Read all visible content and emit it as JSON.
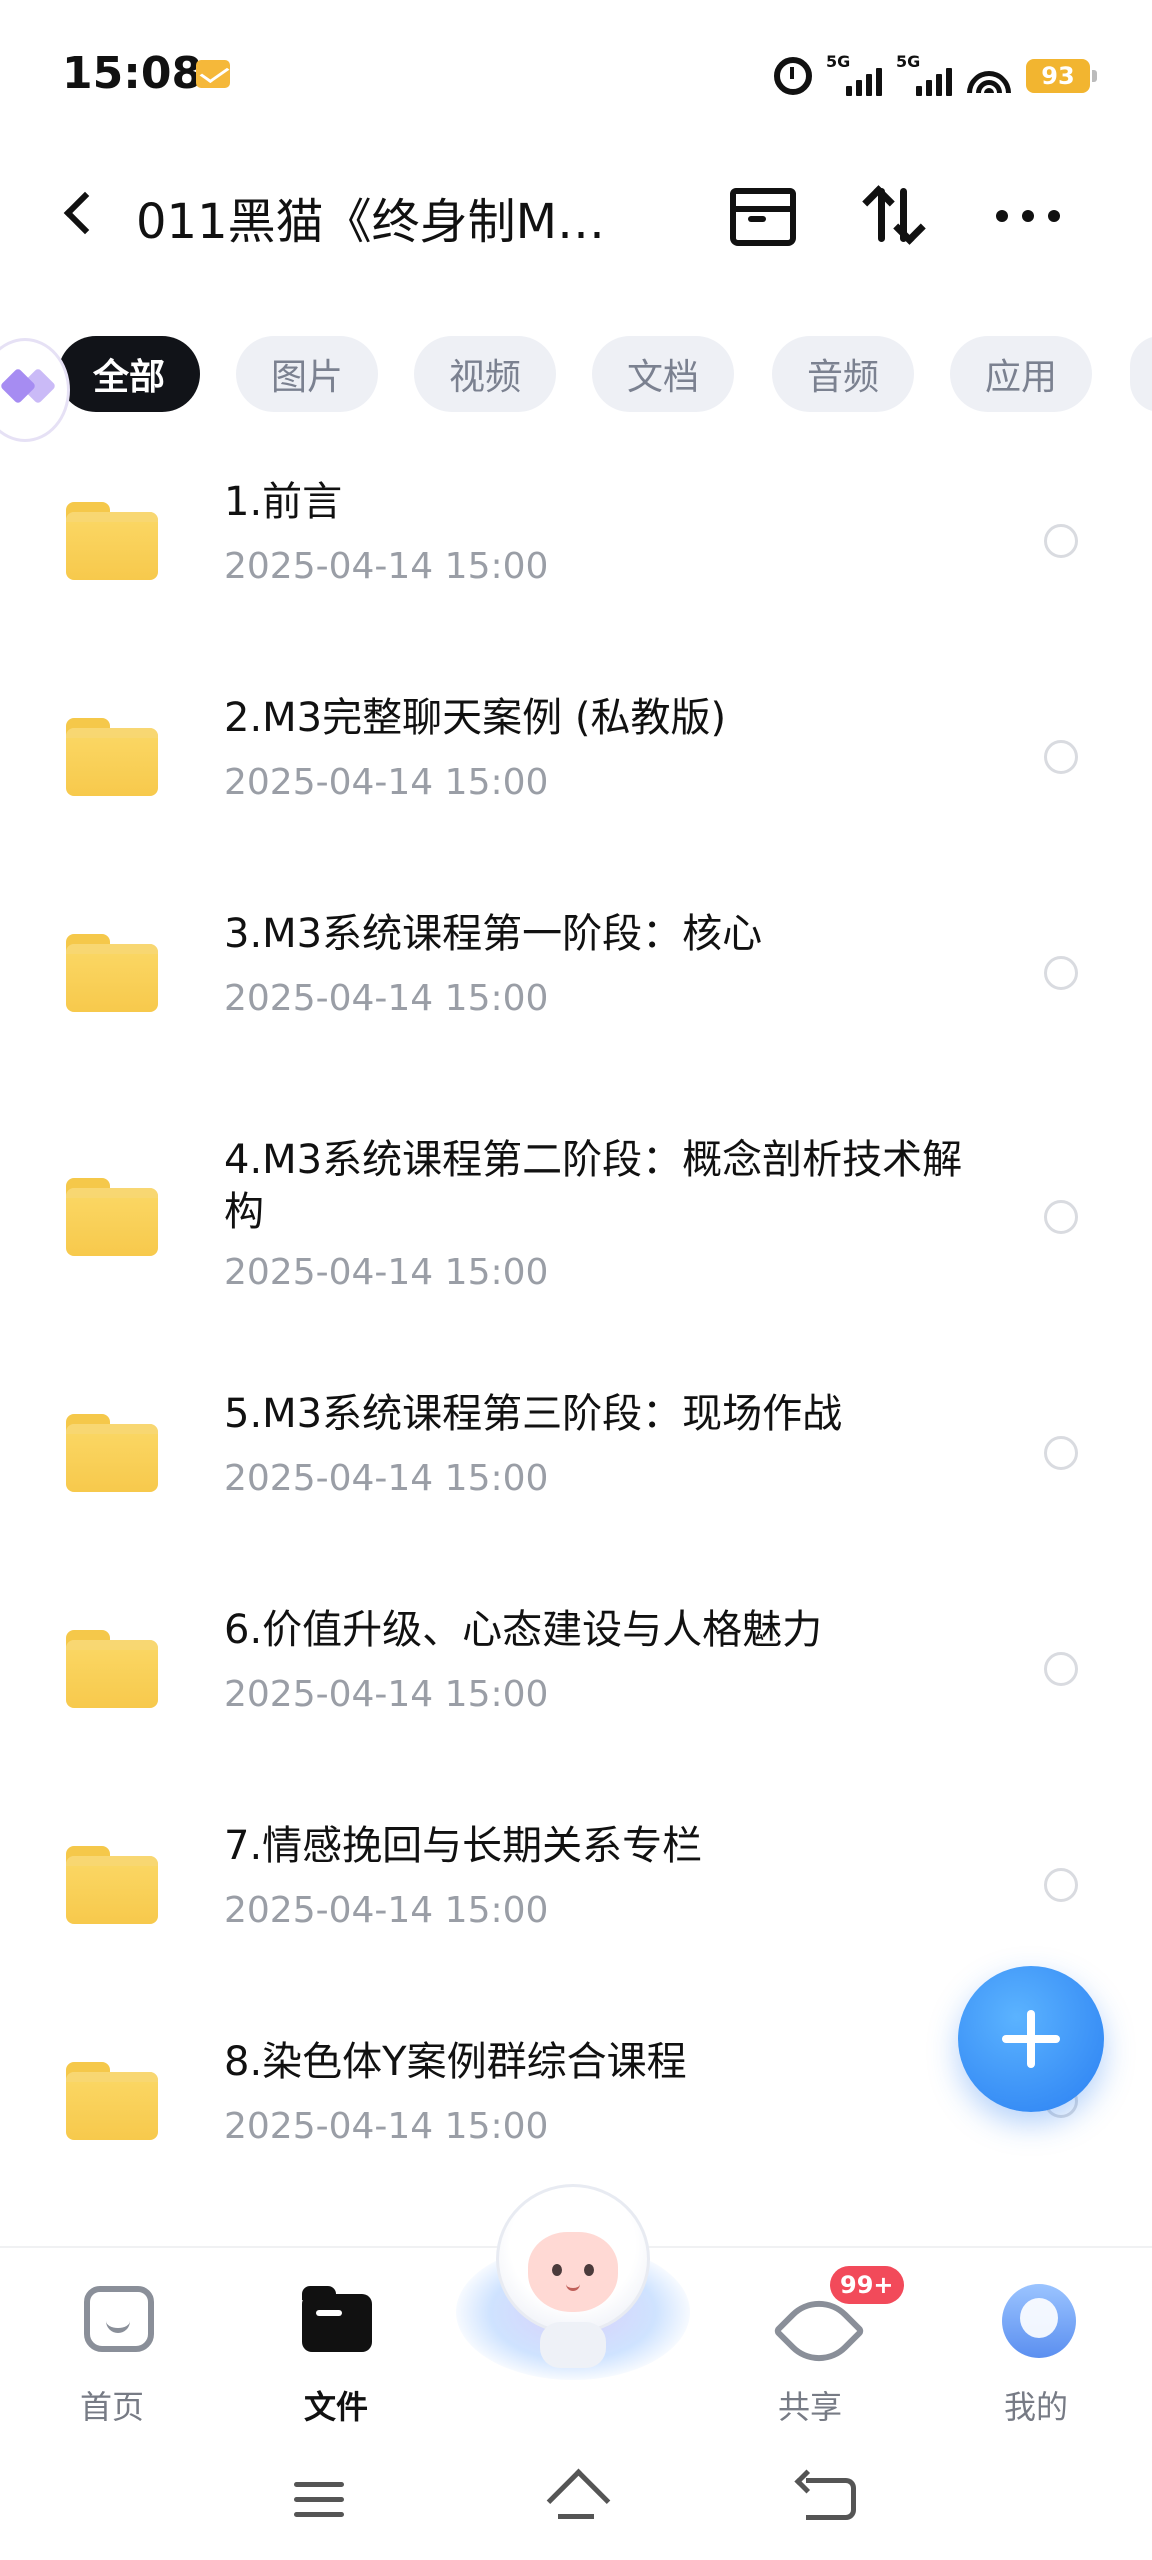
{
  "status_bar": {
    "time": "15:08",
    "signal1_label": "5G",
    "signal2_label": "5G",
    "battery": "93",
    "icons": [
      "mail-icon",
      "alarm-icon",
      "signal-icon",
      "wifi-icon",
      "battery-icon"
    ]
  },
  "header": {
    "title": "011黑猫《终身制M…",
    "icons": [
      "back-icon",
      "archive-icon",
      "sort-icon",
      "more-icon"
    ]
  },
  "filters": [
    {
      "label": "全部",
      "active": true
    },
    {
      "label": "图片",
      "active": false
    },
    {
      "label": "视频",
      "active": false
    },
    {
      "label": "文档",
      "active": false
    },
    {
      "label": "音频",
      "active": false
    },
    {
      "label": "应用",
      "active": false
    }
  ],
  "files": [
    {
      "name": "1.前言",
      "date": "2025-04-14  15:00",
      "checked": false
    },
    {
      "name": "2.M3完整聊天案例 (私教版)",
      "date": "2025-04-14  15:00",
      "checked": false
    },
    {
      "name": "3.M3系统课程第一阶段：核心",
      "date": "2025-04-14  15:00",
      "checked": false
    },
    {
      "name": "4.M3系统课程第二阶段：概念剖析技术解构",
      "date": "2025-04-14  15:00",
      "checked": false
    },
    {
      "name": "5.M3系统课程第三阶段：现场作战",
      "date": "2025-04-14  15:00",
      "checked": false
    },
    {
      "name": "6.价值升级、心态建设与人格魅力",
      "date": "2025-04-14  15:00",
      "checked": false
    },
    {
      "name": "7.情感挽回与长期关系专栏",
      "date": "2025-04-14  15:00",
      "checked": false
    },
    {
      "name": "8.染色体Y案例群综合课程",
      "date": "2025-04-14  15:00",
      "checked": false
    }
  ],
  "bottom_nav": [
    {
      "label": "首页",
      "icon": "home-icon",
      "active": false
    },
    {
      "label": "文件",
      "icon": "folder-icon",
      "active": true
    },
    {
      "label": "共享",
      "icon": "share-icon",
      "active": false,
      "badge": "99+"
    },
    {
      "label": "我的",
      "icon": "profile-icon",
      "active": false
    }
  ],
  "colors": {
    "accent": "#2a7ff2",
    "folder": "#f7c94c",
    "badge": "#f24a5a",
    "battery": "#f2b530"
  }
}
